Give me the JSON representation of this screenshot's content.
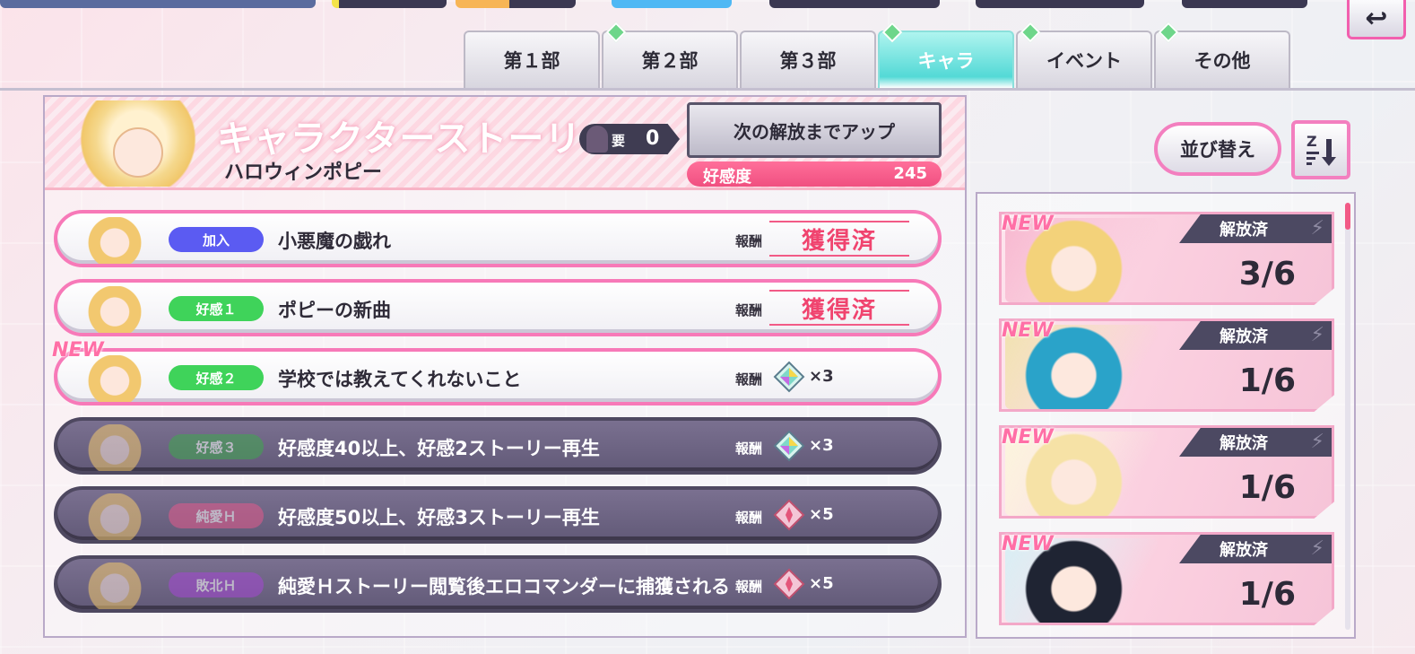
{
  "tabs": [
    {
      "label": "第１部",
      "active": false,
      "badge": false
    },
    {
      "label": "第２部",
      "active": false,
      "badge": true
    },
    {
      "label": "第３部",
      "active": false,
      "badge": false
    },
    {
      "label": "キャラ",
      "active": true,
      "badge": true
    },
    {
      "label": "イベント",
      "active": false,
      "badge": true
    },
    {
      "label": "その他",
      "active": false,
      "badge": true
    }
  ],
  "header": {
    "title": "キャラクターストーリー",
    "character_name": "ハロウィンポピー",
    "requirement_label": "要",
    "requirement_value": "0",
    "unlock_button": "次の解放までアップ",
    "affinity_label": "好感度",
    "affinity_value": "245"
  },
  "reward_label": "報酬",
  "obtained_text": "獲得済",
  "new_label": "NEW",
  "stories": [
    {
      "tag": "加入",
      "tag_color": "#5b5bf2",
      "title": "小悪魔の戯れ",
      "reward": "obtained",
      "locked": false,
      "new": false
    },
    {
      "tag": "好感１",
      "tag_color": "#3fd35a",
      "title": "ポピーの新曲",
      "reward": "obtained",
      "locked": false,
      "new": false
    },
    {
      "tag": "好感２",
      "tag_color": "#3fd35a",
      "title": "学校では教えてくれないこと",
      "reward": "×3",
      "gem": "crystal",
      "locked": false,
      "new": true
    },
    {
      "tag": "好感３",
      "tag_color": "#3fa84e",
      "title": "好感度40以上、好感2ストーリー再生",
      "reward": "×3",
      "gem": "crystal",
      "locked": true,
      "new": false
    },
    {
      "tag": "純愛Ｈ",
      "tag_color": "#e45a8c",
      "title": "好感度50以上、好感3ストーリー再生",
      "reward": "×5",
      "gem": "pink",
      "locked": true,
      "new": false
    },
    {
      "tag": "敗北Ｈ",
      "tag_color": "#a547d4",
      "title": "純愛Ｈストーリー閲覧後エロコマンダーに捕獲される",
      "reward": "×5",
      "gem": "pink",
      "locked": true,
      "new": false
    }
  ],
  "sidebar": {
    "sort_label": "並び替え",
    "order_icon": "sort-desc-icon",
    "cards": [
      {
        "status": "解放済",
        "count": "3/6",
        "new": true,
        "hair": "#f3d27a",
        "accent": "#f7b7cf"
      },
      {
        "status": "解放済",
        "count": "1/6",
        "new": true,
        "hair": "#2aa3c9",
        "accent": "#f1e1b0"
      },
      {
        "status": "解放済",
        "count": "1/6",
        "new": true,
        "hair": "#f6e2a6",
        "accent": "#fbf4dc"
      },
      {
        "status": "解放済",
        "count": "1/6",
        "new": true,
        "hair": "#1f2433",
        "accent": "#d8eef4"
      }
    ]
  },
  "colors": {
    "accent_pink": "#f25a86",
    "active_tab": "#53d9d6",
    "locked_row": "#6b6380"
  }
}
